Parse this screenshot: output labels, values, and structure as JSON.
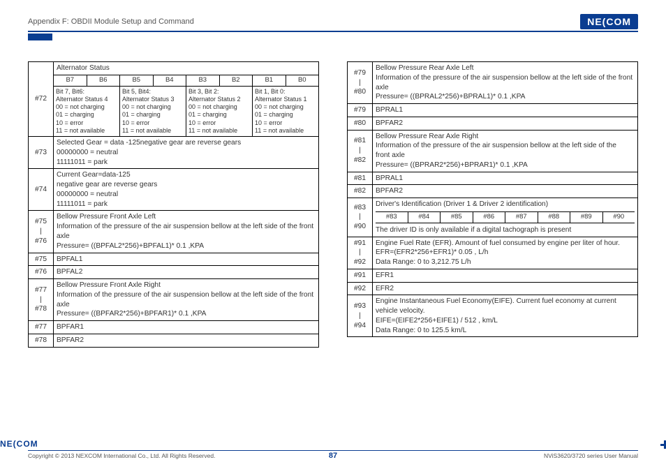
{
  "header": {
    "appendix": "Appendix F: OBDII Module Setup and Command",
    "logo": "NE(COM"
  },
  "left": {
    "r72": {
      "idx": "#72",
      "title": "Alternator Status",
      "bits": [
        "B7",
        "B6",
        "B5",
        "B4",
        "B3",
        "B2",
        "B1",
        "B0"
      ],
      "g1h": "Bit 7, Bit6:",
      "g1t": "Alternator Status 4",
      "g2h": "Bit 5, Bit4:",
      "g2t": "Alternator Status 3",
      "g3h": "Bit 3, Bit 2:",
      "g3t": "Alternator Status 2",
      "g4h": "Bit 1, Bit 0:",
      "g4t": "Alternator Status 1",
      "line1": "00 = not charging",
      "line2": "01 = charging",
      "line3": "10 = error",
      "line4": "11 = not available"
    },
    "r73": {
      "idx": "#73",
      "l1": "Selected Gear = data -125negative gear are reverse gears",
      "l2": "00000000 = neutral",
      "l3": "11111011 = park"
    },
    "r74": {
      "idx": "#74",
      "l1": "Current Gear=data-125",
      "l2": "negative gear are reverse gears",
      "l3": "00000000 = neutral",
      "l4": "11111011 = park"
    },
    "r7576": {
      "idx": "#75\n|\n#76",
      "l1": "Bellow Pressure Front Axle Left",
      "l2": "Information of the pressure of the air suspension bellow at the left side of the front axle",
      "l3": "Pressure= ((BPFAL2*256)+BPFAL1)* 0.1 ,KPA"
    },
    "r75": {
      "idx": "#75",
      "val": "BPFAL1"
    },
    "r76": {
      "idx": "#76",
      "val": "BPFAL2"
    },
    "r7778": {
      "idx": "#77\n|\n#78",
      "l1": "Bellow Pressure Front Axle Right",
      "l2": "Information of the pressure of the air suspension bellow at the left side of the front axle",
      "l3": "Pressure= ((BPFAR2*256)+BPFAR1)* 0.1 ,KPA"
    },
    "r77": {
      "idx": "#77",
      "val": "BPFAR1"
    },
    "r78": {
      "idx": "#78",
      "val": "BPFAR2"
    }
  },
  "right": {
    "r7980": {
      "idx": "#79\n|\n#80",
      "l1": "Bellow Pressure Rear Axle Left",
      "l2": "Information of the pressure of the air suspension bellow at the left side of the front axle",
      "l3": "Pressure= ((BPRAL2*256)+BPRAL1)* 0.1 ,KPA"
    },
    "r79": {
      "idx": "#79",
      "val": "BPRAL1"
    },
    "r80": {
      "idx": "#80",
      "val": "BPFAR2"
    },
    "r8182": {
      "idx": "#81\n|\n#82",
      "l1": "Bellow Pressure Rear Axle Right",
      "l2": "Information of the pressure of the air suspension bellow at the left side of the",
      "l3": "front axle",
      "l4": "Pressure= ((BPRAR2*256)+BPRAR1)* 0.1 ,KPA"
    },
    "r81": {
      "idx": "#81",
      "val": "BPRAL1"
    },
    "r82": {
      "idx": "#82",
      "val": "BPFAR2"
    },
    "r8390": {
      "idx": "#83\n|\n#90",
      "l1": "Driver's Identification (Driver 1 & Driver 2 identification)",
      "cells": [
        "#83",
        "#84",
        "#85",
        "#86",
        "#87",
        "#88",
        "#89",
        "#90"
      ],
      "l2": "The driver ID is only available if a digital tachograph is present"
    },
    "r9192": {
      "idx": "#91\n|\n#92",
      "l1": "Engine Fuel Rate (EFR). Amount of fuel consumed by engine per liter of hour.",
      "l2": "EFR=(EFR2*256+EFR1)* 0.05 , L/h",
      "l3": "Data Range: 0 to 3,212.75 L/h"
    },
    "r91": {
      "idx": "#91",
      "val": "EFR1"
    },
    "r92": {
      "idx": "#92",
      "val": "EFR2"
    },
    "r9394": {
      "idx": "#93\n|\n#94",
      "l1": "Engine Instantaneous Fuel Economy(EIFE). Current fuel economy at current vehicle velocity.",
      "l2": "EIFE=(EIFE2*256+EIFE1) / 512 , km/L",
      "l3": "Data Range: 0 to 125.5 km/L"
    }
  },
  "footer": {
    "logo": "NE(COM",
    "copyright": "Copyright © 2013 NEXCOM International Co., Ltd. All Rights Reserved.",
    "page": "87",
    "manual": "NViS3620/3720 series User Manual"
  }
}
